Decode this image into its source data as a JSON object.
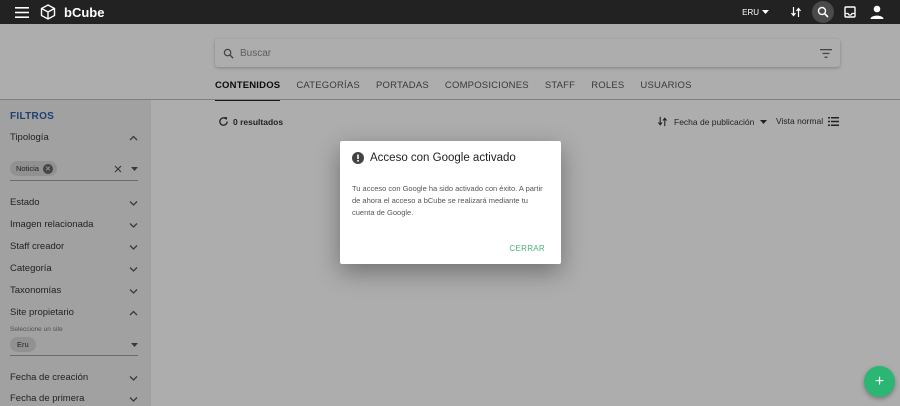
{
  "app": {
    "title": "bCube"
  },
  "topbar": {
    "language": "ERU"
  },
  "search": {
    "placeholder": "Buscar"
  },
  "tabs": [
    {
      "label": "CONTENIDOS",
      "active": true
    },
    {
      "label": "CATEGORÍAS"
    },
    {
      "label": "PORTADAS"
    },
    {
      "label": "COMPOSICIONES"
    },
    {
      "label": "STAFF"
    },
    {
      "label": "ROLES"
    },
    {
      "label": "USUARIOS"
    }
  ],
  "sidebar": {
    "title": "FILTROS",
    "filters": [
      "Tipología",
      "Estado",
      "Imagen relacionada",
      "Staff creador",
      "Categoría",
      "Taxonomías",
      "Site propietario",
      "Fecha de creación",
      "Fecha de primera"
    ],
    "tipologia_chip": "Noticia",
    "site_caption": "Seleccione un site",
    "site_chip": "Eru"
  },
  "results": {
    "text": "0 resultados"
  },
  "sort": {
    "label": "Fecha de publicación"
  },
  "view": {
    "label": "Vista normal"
  },
  "dialog": {
    "title": "Acceso con Google activado",
    "body": "Tu acceso con Google ha sido activado con éxito. A partir de ahora el acceso a bCube se realizará mediante tu cuenta de Google.",
    "button": "CERRAR"
  },
  "fab": {
    "label": "+"
  },
  "colors": {
    "accent": "#2bb673",
    "filters_title": "#2f5ea8",
    "topbar": "#222222"
  }
}
